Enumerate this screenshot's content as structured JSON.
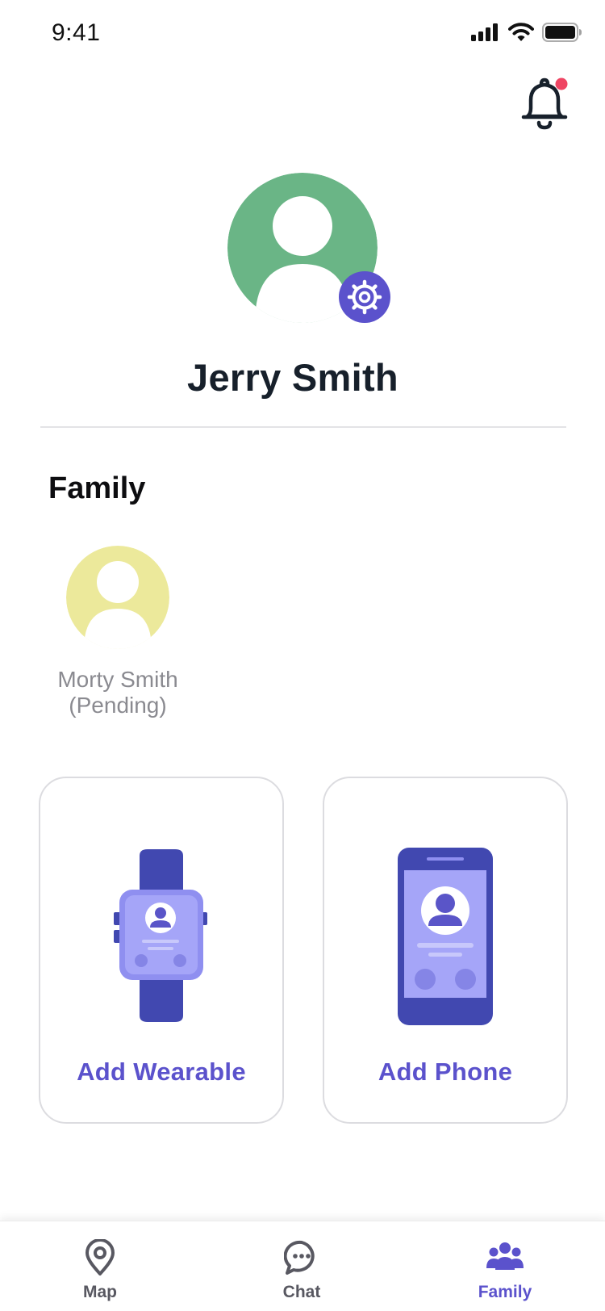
{
  "status_bar": {
    "time": "9:41"
  },
  "notifications": {
    "icon": "bell-icon",
    "has_unread": true,
    "dot_color": "#ef4563"
  },
  "profile": {
    "name": "Jerry Smith",
    "avatar_color": "#6ab586",
    "settings_icon": "gear-icon",
    "badge_color": "#5b52cc"
  },
  "family": {
    "title": "Family",
    "members": [
      {
        "name": "Morty Smith",
        "status": "(Pending)",
        "avatar_color": "#ece99b"
      }
    ]
  },
  "add_devices": [
    {
      "label": "Add Wearable",
      "icon": "smartwatch-icon"
    },
    {
      "label": "Add Phone",
      "icon": "smartphone-icon"
    }
  ],
  "tab_bar": {
    "tabs": [
      {
        "label": "Map",
        "icon": "map-pin-icon",
        "active": false
      },
      {
        "label": "Chat",
        "icon": "chat-bubble-icon",
        "active": false
      },
      {
        "label": "Family",
        "icon": "family-group-icon",
        "active": true
      }
    ]
  },
  "colors": {
    "accent": "#5b52cc",
    "device_dark": "#4148b0",
    "device_light": "#8f8ff0",
    "text_dark": "#17202b",
    "text_muted": "#8a8a90"
  }
}
